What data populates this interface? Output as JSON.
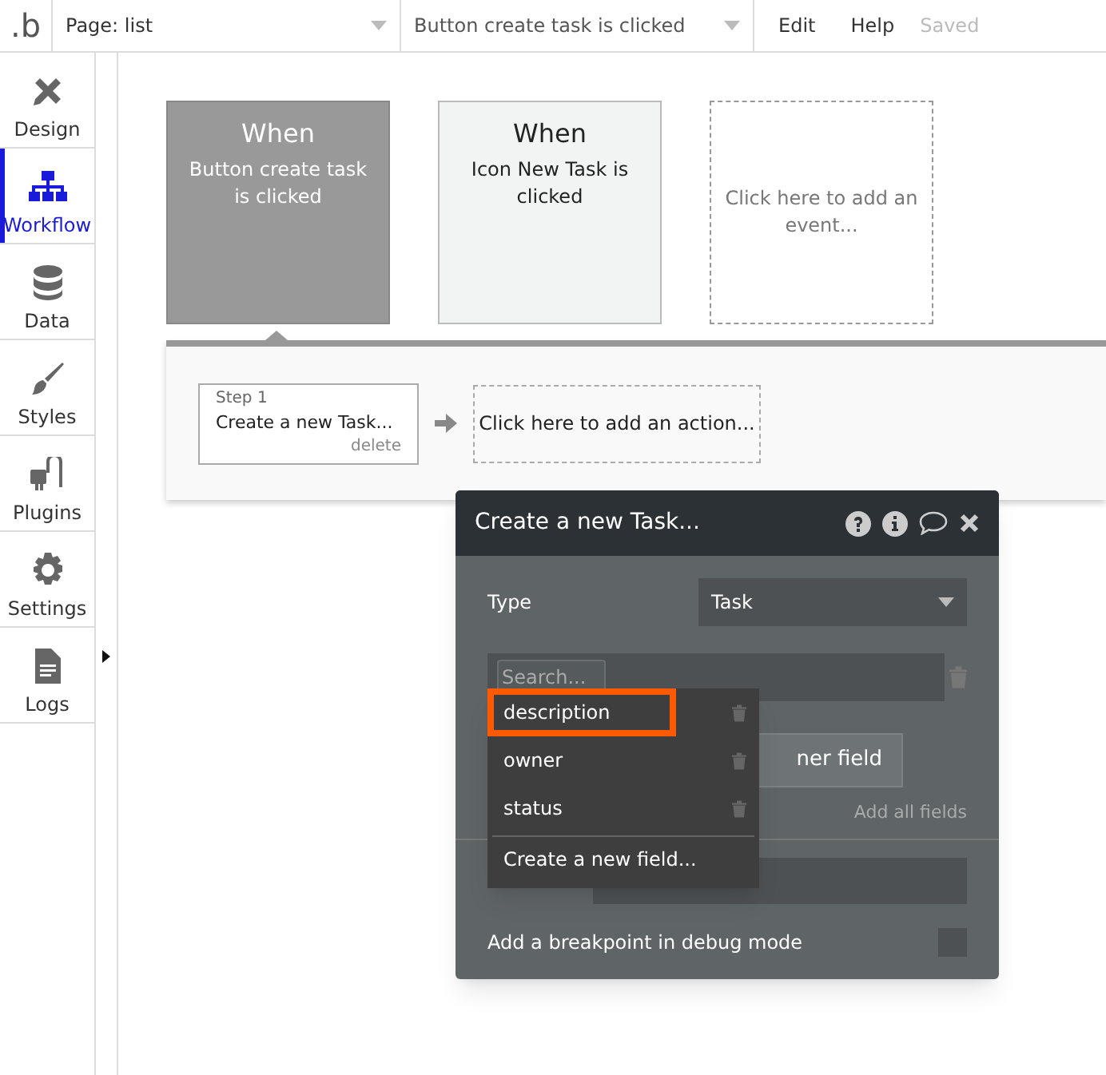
{
  "top_bar": {
    "logo": ".b",
    "page_select": "Page: list",
    "event_select": "Button create task is clicked",
    "menu": [
      "Edit",
      "Help"
    ],
    "save_status": "Saved"
  },
  "sidebar": {
    "items": [
      {
        "label": "Design",
        "selected": false
      },
      {
        "label": "Workflow",
        "selected": true
      },
      {
        "label": "Data",
        "selected": false
      },
      {
        "label": "Styles",
        "selected": false
      },
      {
        "label": "Plugins",
        "selected": false
      },
      {
        "label": "Settings",
        "selected": false
      },
      {
        "label": "Logs",
        "selected": false
      }
    ]
  },
  "events": [
    {
      "kind": "event",
      "heading": "When",
      "text": "Button create task is clicked",
      "selected": true
    },
    {
      "kind": "event",
      "heading": "When",
      "text": "Icon New Task is clicked",
      "selected": false
    },
    {
      "kind": "add",
      "text": "Click here to add an event..."
    }
  ],
  "actions": {
    "steps": [
      {
        "step": "Step 1",
        "title": "Create a new Task...",
        "delete": "delete"
      }
    ],
    "add_action": "Click here to add an action..."
  },
  "dialog": {
    "title": "Create a new Task...",
    "type_label": "Type",
    "type_value": "Task",
    "search_placeholder": "Search...",
    "add_field_button": "ner field",
    "add_all": "Add all fields",
    "breakpoint_label": "Add a breakpoint in debug mode",
    "breakpoint_checked": false,
    "dropdown": {
      "items": [
        {
          "label": "description",
          "selected": true
        },
        {
          "label": "owner",
          "selected": false
        },
        {
          "label": "status",
          "selected": false
        }
      ],
      "create": "Create a new field..."
    }
  }
}
